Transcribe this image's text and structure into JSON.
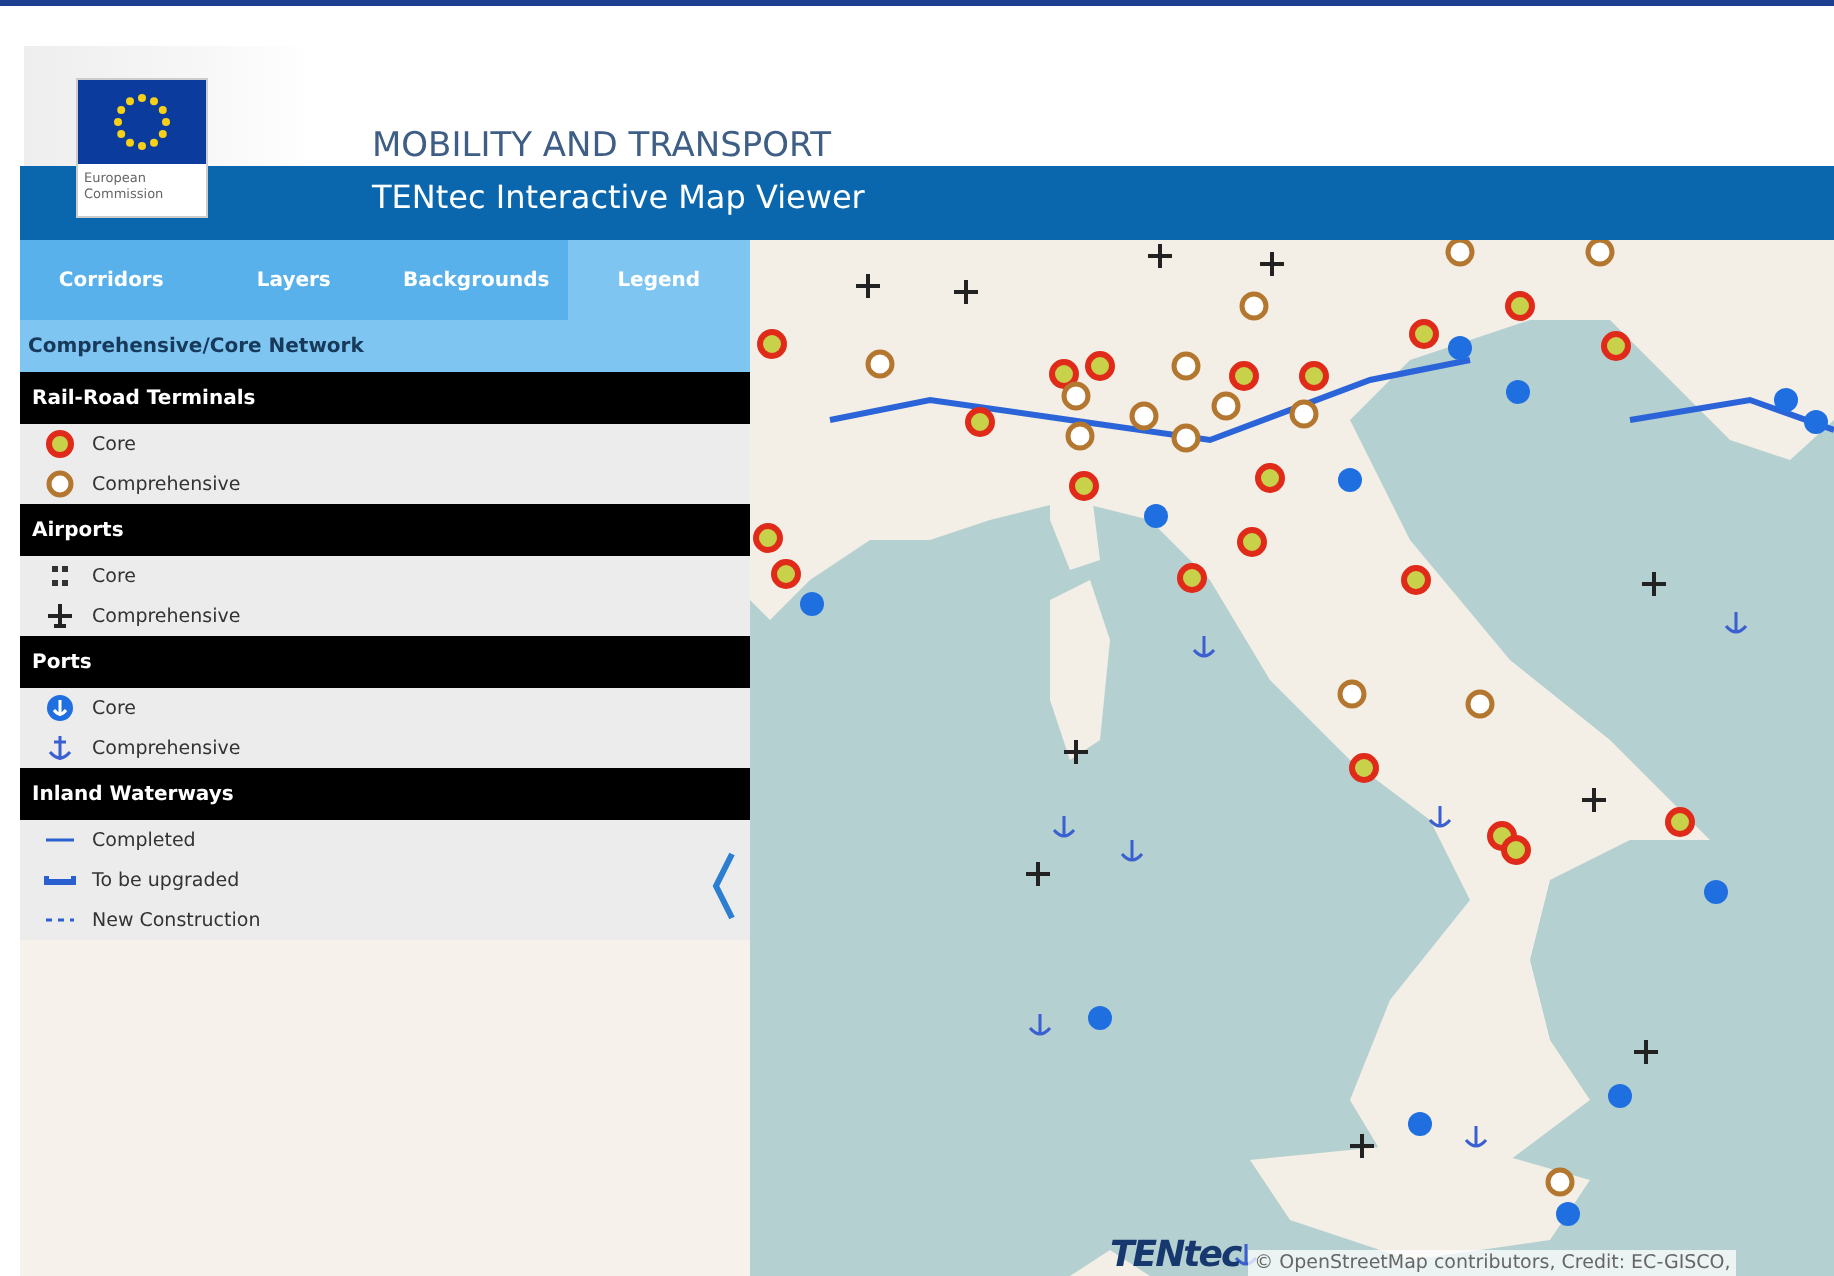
{
  "header": {
    "logo_text": "European Commission",
    "title": "MOBILITY AND TRANSPORT",
    "subtitle": "TENtec Interactive Map Viewer"
  },
  "tabs": [
    {
      "label": "Corridors",
      "selected": false
    },
    {
      "label": "Layers",
      "selected": false
    },
    {
      "label": "Backgrounds",
      "selected": false
    },
    {
      "label": "Legend",
      "selected": true
    }
  ],
  "legend": {
    "title": "Comprehensive/Core Network",
    "sections": [
      {
        "title": "Rail-Road Terminals",
        "items": [
          {
            "kind": "rail-core",
            "label": "Core"
          },
          {
            "kind": "rail-comprehensive",
            "label": "Comprehensive"
          }
        ]
      },
      {
        "title": "Airports",
        "items": [
          {
            "kind": "airport-core",
            "label": "Core"
          },
          {
            "kind": "airport-comprehensive",
            "label": "Comprehensive"
          }
        ]
      },
      {
        "title": "Ports",
        "items": [
          {
            "kind": "port-core",
            "label": "Core"
          },
          {
            "kind": "port-comprehensive",
            "label": "Comprehensive"
          }
        ]
      },
      {
        "title": "Inland Waterways",
        "items": [
          {
            "kind": "line-solid",
            "label": "Completed"
          },
          {
            "kind": "line-thick",
            "label": "To be upgraded"
          },
          {
            "kind": "line-dashed",
            "label": "New Construction"
          }
        ]
      }
    ]
  },
  "map": {
    "brand": "TENtec",
    "attribution": "© OpenStreetMap contributors, Credit: EC-GISCO,"
  }
}
